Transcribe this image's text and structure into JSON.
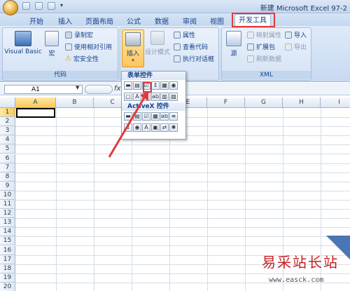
{
  "window": {
    "title": "新建 Microsoft Excel 97-2"
  },
  "tabs": [
    "开始",
    "插入",
    "页面布局",
    "公式",
    "数据",
    "审阅",
    "视图",
    "开发工具"
  ],
  "active_tab": "开发工具",
  "ribbon": {
    "code_group": {
      "label": "代码",
      "visual_basic": "Visual Basic",
      "macro": "宏",
      "record_macro": "录制宏",
      "relative_ref": "使用相对引用",
      "macro_security": "宏安全性"
    },
    "controls_group": {
      "insert": "插入",
      "design_mode": "设计模式",
      "properties": "属性",
      "view_code": "查看代码",
      "run_dialog": "执行对话框"
    },
    "xml_group": {
      "label": "XML",
      "source": "源",
      "map_properties": "映射属性",
      "expansion_packs": "扩展包",
      "refresh_data": "刷新数据",
      "import": "导入",
      "export": "导出"
    }
  },
  "formula_bar": {
    "name_box": "A1",
    "fx": "fx"
  },
  "columns": [
    "A",
    "B",
    "C",
    "D",
    "E",
    "F",
    "G",
    "H",
    "I"
  ],
  "rows": [
    "1",
    "2",
    "3",
    "4",
    "5",
    "6",
    "7",
    "8",
    "9",
    "10",
    "11",
    "12",
    "13",
    "14",
    "15",
    "16",
    "17",
    "18",
    "19",
    "20"
  ],
  "insert_menu": {
    "form_controls_label": "表单控件",
    "activex_label": "ActiveX 控件"
  },
  "watermark": {
    "text": "易采站长站",
    "url": "www.easck.com"
  },
  "colors": {
    "highlight": "#e23a3a",
    "ribbon": "#c7d9f1",
    "active_tab_bg": "#ffffff"
  }
}
